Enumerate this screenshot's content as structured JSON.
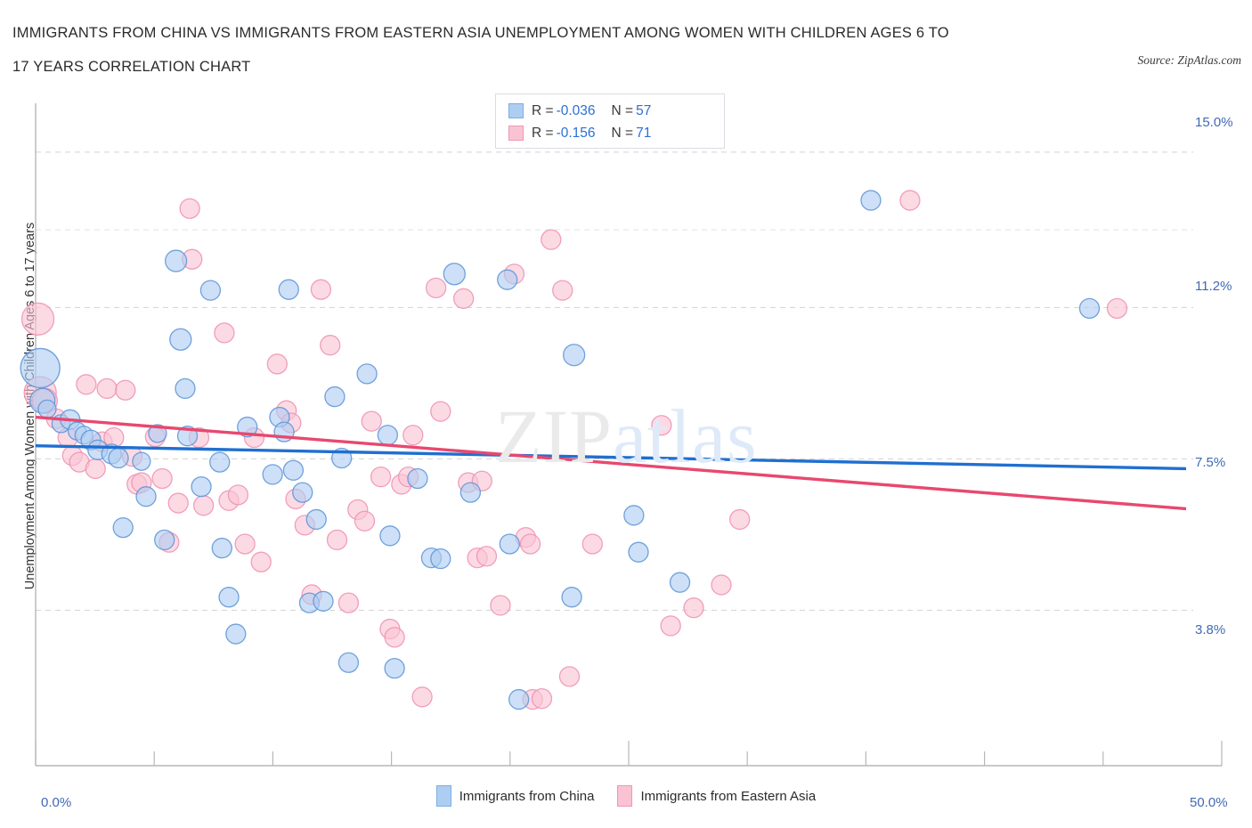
{
  "header": {
    "title_line1": "IMMIGRANTS FROM CHINA VS IMMIGRANTS FROM EASTERN ASIA UNEMPLOYMENT AMONG WOMEN WITH CHILDREN AGES 6 TO",
    "title_line2": "17 YEARS CORRELATION CHART",
    "source": "Source: ZipAtlas.com"
  },
  "watermark": {
    "part1": "ZIP",
    "part2": "atlas"
  },
  "stats_legend": {
    "rows": [
      {
        "series": "Immigrants from China",
        "r_key": "R =",
        "r_value": "-0.036",
        "n_key": "N =",
        "n_value": "57",
        "color": "#aecdf2"
      },
      {
        "series": "Immigrants from Eastern Asia",
        "r_key": "R =",
        "r_value": "-0.156",
        "n_key": "N =",
        "n_value": "71",
        "color": "#fac3d4"
      }
    ]
  },
  "bottom_legend": {
    "items": [
      {
        "label": "Immigrants from China",
        "color": "#aecdf2",
        "border": "#7aaee2"
      },
      {
        "label": "Immigrants from Eastern Asia",
        "color": "#fac3d4",
        "border": "#f294b4"
      }
    ]
  },
  "chart_data": {
    "type": "scatter",
    "title": "IMMIGRANTS FROM CHINA VS IMMIGRANTS FROM EASTERN ASIA UNEMPLOYMENT AMONG WOMEN WITH CHILDREN AGES 6 TO 17 YEARS CORRELATION CHART",
    "xlabel": "",
    "ylabel": "Unemployment Among Women with Children Ages 6 to 17 years",
    "xlim": [
      0.0,
      50.0
    ],
    "ylim": [
      0.0,
      16.15
    ],
    "grid": true,
    "xticks": [
      "0.0%",
      "50.0%"
    ],
    "yticks": [
      "15.0%",
      "11.2%",
      "7.5%",
      "3.8%"
    ],
    "ytick_values": [
      15.0,
      11.2,
      7.5,
      3.8
    ],
    "legend_position": "bottom-center",
    "series": [
      {
        "name": "Immigrants from China",
        "color": "#aecdf2",
        "border": "#5a93d6",
        "r": -0.036,
        "n": 57,
        "trendline": {
          "x0": 0.0,
          "y0": 7.82,
          "x1": 50.0,
          "y1": 7.26
        },
        "points": [
          {
            "x": 0.2,
            "y": 9.72,
            "r": 22
          },
          {
            "x": 0.3,
            "y": 8.92,
            "r": 14
          },
          {
            "x": 0.5,
            "y": 8.72,
            "r": 10
          },
          {
            "x": 1.1,
            "y": 8.36,
            "r": 10
          },
          {
            "x": 1.5,
            "y": 8.46,
            "r": 11
          },
          {
            "x": 1.8,
            "y": 8.18,
            "r": 10
          },
          {
            "x": 2.1,
            "y": 8.08,
            "r": 10
          },
          {
            "x": 2.4,
            "y": 7.96,
            "r": 11
          },
          {
            "x": 2.7,
            "y": 7.72,
            "r": 11
          },
          {
            "x": 3.3,
            "y": 7.62,
            "r": 11
          },
          {
            "x": 3.6,
            "y": 7.52,
            "r": 11
          },
          {
            "x": 3.8,
            "y": 5.82,
            "r": 11
          },
          {
            "x": 4.6,
            "y": 7.44,
            "r": 10
          },
          {
            "x": 4.8,
            "y": 6.58,
            "r": 11
          },
          {
            "x": 5.3,
            "y": 8.12,
            "r": 10
          },
          {
            "x": 5.6,
            "y": 5.52,
            "r": 11
          },
          {
            "x": 6.1,
            "y": 12.34,
            "r": 12
          },
          {
            "x": 6.3,
            "y": 10.42,
            "r": 12
          },
          {
            "x": 6.5,
            "y": 9.22,
            "r": 11
          },
          {
            "x": 6.6,
            "y": 8.06,
            "r": 11
          },
          {
            "x": 7.2,
            "y": 6.82,
            "r": 11
          },
          {
            "x": 7.6,
            "y": 11.62,
            "r": 11
          },
          {
            "x": 8.0,
            "y": 7.42,
            "r": 11
          },
          {
            "x": 8.1,
            "y": 5.32,
            "r": 11
          },
          {
            "x": 8.4,
            "y": 4.12,
            "r": 11
          },
          {
            "x": 8.7,
            "y": 3.22,
            "r": 11
          },
          {
            "x": 9.2,
            "y": 8.28,
            "r": 11
          },
          {
            "x": 10.3,
            "y": 7.12,
            "r": 11
          },
          {
            "x": 10.6,
            "y": 8.52,
            "r": 11
          },
          {
            "x": 10.8,
            "y": 8.16,
            "r": 11
          },
          {
            "x": 11.0,
            "y": 11.64,
            "r": 11
          },
          {
            "x": 11.2,
            "y": 7.22,
            "r": 11
          },
          {
            "x": 11.6,
            "y": 6.68,
            "r": 11
          },
          {
            "x": 11.9,
            "y": 3.98,
            "r": 11
          },
          {
            "x": 12.2,
            "y": 6.02,
            "r": 11
          },
          {
            "x": 12.5,
            "y": 4.02,
            "r": 11
          },
          {
            "x": 13.0,
            "y": 9.02,
            "r": 11
          },
          {
            "x": 13.3,
            "y": 7.52,
            "r": 11
          },
          {
            "x": 13.6,
            "y": 2.52,
            "r": 11
          },
          {
            "x": 14.4,
            "y": 9.58,
            "r": 11
          },
          {
            "x": 15.3,
            "y": 8.08,
            "r": 11
          },
          {
            "x": 15.4,
            "y": 5.62,
            "r": 11
          },
          {
            "x": 15.6,
            "y": 2.38,
            "r": 11
          },
          {
            "x": 16.6,
            "y": 7.02,
            "r": 11
          },
          {
            "x": 17.2,
            "y": 5.08,
            "r": 11
          },
          {
            "x": 17.6,
            "y": 5.06,
            "r": 11
          },
          {
            "x": 18.2,
            "y": 12.02,
            "r": 12
          },
          {
            "x": 18.9,
            "y": 6.68,
            "r": 11
          },
          {
            "x": 20.5,
            "y": 11.88,
            "r": 11
          },
          {
            "x": 20.6,
            "y": 5.42,
            "r": 11
          },
          {
            "x": 21.0,
            "y": 1.62,
            "r": 11
          },
          {
            "x": 23.4,
            "y": 10.04,
            "r": 12
          },
          {
            "x": 23.3,
            "y": 4.12,
            "r": 11
          },
          {
            "x": 26.0,
            "y": 6.12,
            "r": 11
          },
          {
            "x": 26.2,
            "y": 5.22,
            "r": 11
          },
          {
            "x": 28.0,
            "y": 4.48,
            "r": 11
          },
          {
            "x": 36.3,
            "y": 13.82,
            "r": 11
          },
          {
            "x": 45.8,
            "y": 11.18,
            "r": 11
          }
        ]
      },
      {
        "name": "Immigrants from Eastern Asia",
        "color": "#fac3d4",
        "border": "#ef8fb2",
        "r": -0.156,
        "n": 71,
        "trendline": {
          "x0": 0.0,
          "y0": 8.52,
          "x1": 50.0,
          "y1": 6.28
        },
        "points": [
          {
            "x": 0.1,
            "y": 10.92,
            "r": 18
          },
          {
            "x": 0.2,
            "y": 9.12,
            "r": 18
          },
          {
            "x": 0.4,
            "y": 8.92,
            "r": 14
          },
          {
            "x": 0.9,
            "y": 8.48,
            "r": 11
          },
          {
            "x": 1.4,
            "y": 8.02,
            "r": 11
          },
          {
            "x": 1.6,
            "y": 7.58,
            "r": 11
          },
          {
            "x": 1.9,
            "y": 7.42,
            "r": 11
          },
          {
            "x": 2.2,
            "y": 9.32,
            "r": 11
          },
          {
            "x": 2.6,
            "y": 7.26,
            "r": 11
          },
          {
            "x": 2.9,
            "y": 7.92,
            "r": 11
          },
          {
            "x": 3.1,
            "y": 9.22,
            "r": 11
          },
          {
            "x": 3.4,
            "y": 8.02,
            "r": 11
          },
          {
            "x": 3.9,
            "y": 9.18,
            "r": 11
          },
          {
            "x": 4.2,
            "y": 7.56,
            "r": 11
          },
          {
            "x": 4.4,
            "y": 6.88,
            "r": 11
          },
          {
            "x": 4.6,
            "y": 6.92,
            "r": 11
          },
          {
            "x": 5.2,
            "y": 8.04,
            "r": 11
          },
          {
            "x": 5.5,
            "y": 7.02,
            "r": 11
          },
          {
            "x": 5.8,
            "y": 5.46,
            "r": 11
          },
          {
            "x": 6.2,
            "y": 6.42,
            "r": 11
          },
          {
            "x": 6.7,
            "y": 13.62,
            "r": 11
          },
          {
            "x": 6.8,
            "y": 12.38,
            "r": 11
          },
          {
            "x": 7.1,
            "y": 8.02,
            "r": 11
          },
          {
            "x": 7.3,
            "y": 6.36,
            "r": 11
          },
          {
            "x": 8.2,
            "y": 10.58,
            "r": 11
          },
          {
            "x": 8.4,
            "y": 6.48,
            "r": 11
          },
          {
            "x": 8.8,
            "y": 6.62,
            "r": 11
          },
          {
            "x": 9.1,
            "y": 5.42,
            "r": 11
          },
          {
            "x": 9.5,
            "y": 8.02,
            "r": 11
          },
          {
            "x": 9.8,
            "y": 4.98,
            "r": 11
          },
          {
            "x": 10.5,
            "y": 9.82,
            "r": 11
          },
          {
            "x": 10.9,
            "y": 8.68,
            "r": 11
          },
          {
            "x": 11.1,
            "y": 8.38,
            "r": 11
          },
          {
            "x": 11.3,
            "y": 6.52,
            "r": 11
          },
          {
            "x": 11.7,
            "y": 5.88,
            "r": 11
          },
          {
            "x": 12.0,
            "y": 4.18,
            "r": 11
          },
          {
            "x": 12.4,
            "y": 11.64,
            "r": 11
          },
          {
            "x": 12.8,
            "y": 10.28,
            "r": 11
          },
          {
            "x": 13.1,
            "y": 5.52,
            "r": 11
          },
          {
            "x": 13.6,
            "y": 3.98,
            "r": 11
          },
          {
            "x": 14.0,
            "y": 6.26,
            "r": 11
          },
          {
            "x": 14.3,
            "y": 5.98,
            "r": 11
          },
          {
            "x": 14.6,
            "y": 8.42,
            "r": 11
          },
          {
            "x": 15.0,
            "y": 7.06,
            "r": 11
          },
          {
            "x": 15.4,
            "y": 3.34,
            "r": 11
          },
          {
            "x": 15.6,
            "y": 3.14,
            "r": 11
          },
          {
            "x": 15.9,
            "y": 6.88,
            "r": 11
          },
          {
            "x": 16.2,
            "y": 7.06,
            "r": 11
          },
          {
            "x": 16.4,
            "y": 8.08,
            "r": 11
          },
          {
            "x": 16.8,
            "y": 1.68,
            "r": 11
          },
          {
            "x": 17.4,
            "y": 11.68,
            "r": 11
          },
          {
            "x": 17.6,
            "y": 8.66,
            "r": 11
          },
          {
            "x": 18.6,
            "y": 11.42,
            "r": 11
          },
          {
            "x": 18.8,
            "y": 6.92,
            "r": 11
          },
          {
            "x": 19.2,
            "y": 5.08,
            "r": 11
          },
          {
            "x": 19.4,
            "y": 6.96,
            "r": 11
          },
          {
            "x": 19.6,
            "y": 5.12,
            "r": 11
          },
          {
            "x": 20.2,
            "y": 3.92,
            "r": 11
          },
          {
            "x": 20.8,
            "y": 12.02,
            "r": 11
          },
          {
            "x": 21.3,
            "y": 5.58,
            "r": 11
          },
          {
            "x": 21.5,
            "y": 5.42,
            "r": 11
          },
          {
            "x": 21.6,
            "y": 1.62,
            "r": 11
          },
          {
            "x": 22.0,
            "y": 1.64,
            "r": 11
          },
          {
            "x": 22.4,
            "y": 12.86,
            "r": 11
          },
          {
            "x": 22.9,
            "y": 11.62,
            "r": 11
          },
          {
            "x": 23.2,
            "y": 2.18,
            "r": 11
          },
          {
            "x": 24.2,
            "y": 5.42,
            "r": 11
          },
          {
            "x": 27.2,
            "y": 8.32,
            "r": 11
          },
          {
            "x": 27.6,
            "y": 3.42,
            "r": 11
          },
          {
            "x": 28.6,
            "y": 3.86,
            "r": 11
          },
          {
            "x": 29.8,
            "y": 4.42,
            "r": 11
          },
          {
            "x": 30.6,
            "y": 6.02,
            "r": 11
          },
          {
            "x": 38.0,
            "y": 13.82,
            "r": 11
          },
          {
            "x": 47.0,
            "y": 11.18,
            "r": 11
          }
        ]
      }
    ]
  }
}
